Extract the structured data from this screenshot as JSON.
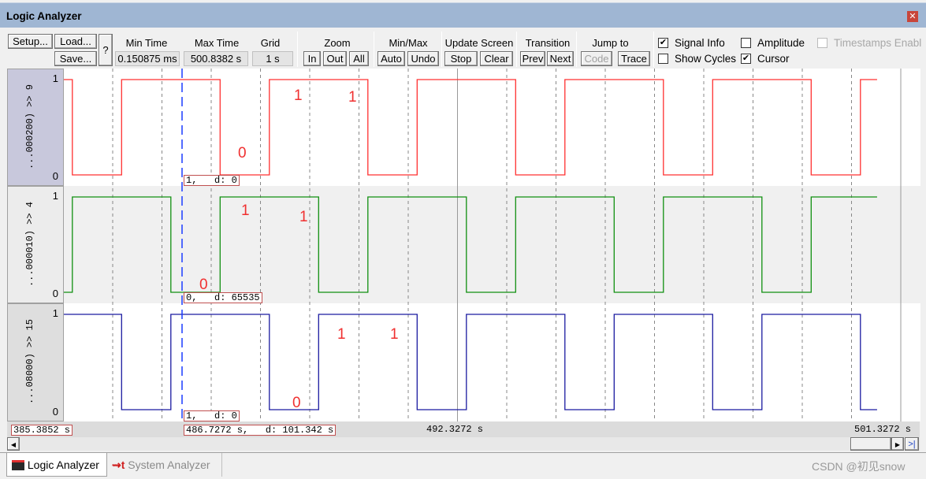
{
  "window": {
    "title": "Logic Analyzer",
    "close_icon": "close-icon"
  },
  "toolbar": {
    "setup": "Setup...",
    "load": "Load...",
    "save": "Save...",
    "help": "?",
    "min_time_label": "Min Time",
    "min_time": "0.150875 ms",
    "max_time_label": "Max Time",
    "max_time": "500.8382 s",
    "grid_label": "Grid",
    "grid": "1 s",
    "zoom_label": "Zoom",
    "zoom_in": "In",
    "zoom_out": "Out",
    "zoom_all": "All",
    "minmax_label": "Min/Max",
    "auto": "Auto",
    "undo": "Undo",
    "update_label": "Update Screen",
    "stop": "Stop",
    "clear": "Clear",
    "transition_label": "Transition",
    "prev": "Prev",
    "next": "Next",
    "jump_label": "Jump to",
    "code": "Code",
    "trace": "Trace",
    "signal_info": {
      "label": "Signal Info",
      "checked": true
    },
    "amplitude": {
      "label": "Amplitude",
      "checked": false
    },
    "timestamps": {
      "label": "Timestamps Enabl",
      "checked": false,
      "disabled": true
    },
    "show_cycles": {
      "label": "Show Cycles",
      "checked": false
    },
    "cursor": {
      "label": "Cursor",
      "checked": true
    }
  },
  "signals": [
    {
      "label": "...000200) >> 9",
      "high": "1",
      "low": "0",
      "color": "#ff3030",
      "initial": 1,
      "edges": [
        484.5,
        485.5,
        487.5,
        488.5,
        490.5,
        491.5,
        493.5,
        494.5,
        496.5,
        497.5,
        499.5,
        500.5
      ],
      "cursor_info": "1,   d: 0",
      "annotations": [
        "1",
        "1",
        "0"
      ]
    },
    {
      "label": "...000010) >> 4",
      "high": "1",
      "low": "0",
      "color": "#109010",
      "initial": 0,
      "edges": [
        484.5,
        486.5,
        487.5,
        489.5,
        490.5,
        492.5,
        493.5,
        495.5,
        496.5,
        498.5,
        499.5
      ],
      "cursor_info": "0,   d: 65535",
      "annotations": [
        "1",
        "1",
        "0"
      ]
    },
    {
      "label": "...08000) >> 15",
      "high": "1",
      "low": "0",
      "color": "#1a1aa0",
      "initial": 1,
      "edges": [
        485.5,
        486.5,
        488.5,
        489.5,
        491.5,
        492.5,
        494.5,
        495.5,
        497.5,
        498.5,
        500.5
      ],
      "cursor_info": "1,   d: 0",
      "annotations": [
        "1",
        "1",
        "0"
      ]
    }
  ],
  "time": {
    "start": 484.3272,
    "end": 500.8382,
    "grid_s": 1,
    "cursor": 486.7272
  },
  "axis": {
    "left_label": "385.3852 s",
    "cursor_label": "486.7272 s,   d: 101.342 s",
    "mid_label": "492.3272 s",
    "right_label": "501.3272 s"
  },
  "scrollbar": {
    "left_icon": "arrow-left-icon",
    "right_icon": "arrow-right-icon",
    "end_icon": "scroll-end-icon"
  },
  "tabs": [
    {
      "label": "Logic Analyzer",
      "active": true,
      "icon": "logic-analyzer-icon"
    },
    {
      "label": "System Analyzer",
      "active": false,
      "icon": "system-analyzer-icon"
    }
  ],
  "watermark": "CSDN @初见snow"
}
